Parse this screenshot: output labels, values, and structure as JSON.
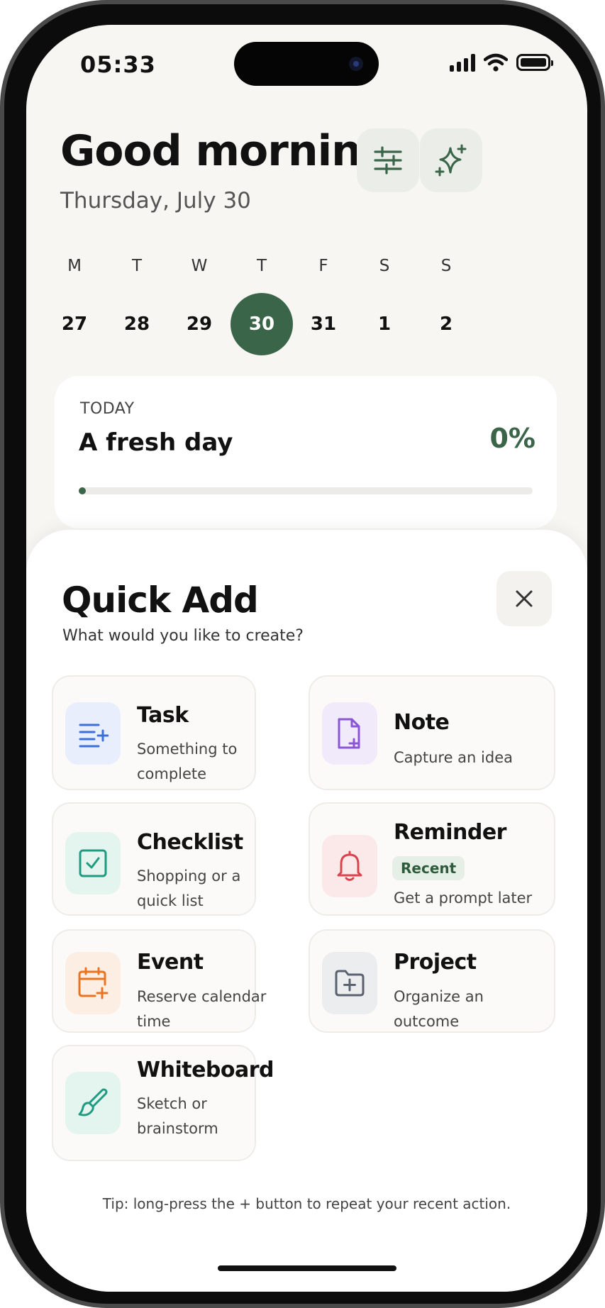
{
  "status_bar": {
    "time": "05:33"
  },
  "header": {
    "greeting": "Good morning",
    "date": "Thursday, July 30"
  },
  "week": [
    {
      "dow": "M",
      "day": "27",
      "selected": false
    },
    {
      "dow": "T",
      "day": "28",
      "selected": false
    },
    {
      "dow": "W",
      "day": "29",
      "selected": false
    },
    {
      "dow": "T",
      "day": "30",
      "selected": true
    },
    {
      "dow": "F",
      "day": "31",
      "selected": false
    },
    {
      "dow": "S",
      "day": "1",
      "selected": false
    },
    {
      "dow": "S",
      "day": "2",
      "selected": false
    }
  ],
  "today": {
    "label": "TODAY",
    "title": "A fresh day",
    "percent_text": "0%",
    "progress": 0
  },
  "quick_add": {
    "title": "Quick Add",
    "subtitle": "What would you like to create?",
    "items": [
      {
        "title": "Task",
        "desc": "Something to complete",
        "icon": "task-list-plus-icon",
        "color": "#3d6fd8",
        "bg": "#e8eefc"
      },
      {
        "title": "Note",
        "desc": "Capture an idea",
        "icon": "note-plus-icon",
        "color": "#8b55d6",
        "bg": "#f0eafb"
      },
      {
        "title": "Checklist",
        "desc": "Shopping or a quick list",
        "icon": "checkbox-icon",
        "color": "#1f9b82",
        "bg": "#e4f4ef"
      },
      {
        "title": "Reminder",
        "badge": "Recent",
        "desc": "Get a prompt later",
        "icon": "bell-icon",
        "color": "#d9434e",
        "bg": "#fbe8e9"
      },
      {
        "title": "Event",
        "desc": "Reserve calendar time",
        "icon": "calendar-plus-icon",
        "color": "#e87524",
        "bg": "#fdeee3"
      },
      {
        "title": "Project",
        "desc": "Organize an outcome",
        "icon": "folder-plus-icon",
        "color": "#5a6270",
        "bg": "#ecedee"
      },
      {
        "title": "Whiteboard",
        "desc": "Sketch or brainstorm",
        "icon": "brush-icon",
        "color": "#1f9b82",
        "bg": "#e4f4ef"
      }
    ],
    "tip": "Tip: long-press the + button to repeat your recent action."
  },
  "colors": {
    "accent": "#3a6549",
    "background": "#f7f6f3",
    "card": "#ffffff"
  }
}
